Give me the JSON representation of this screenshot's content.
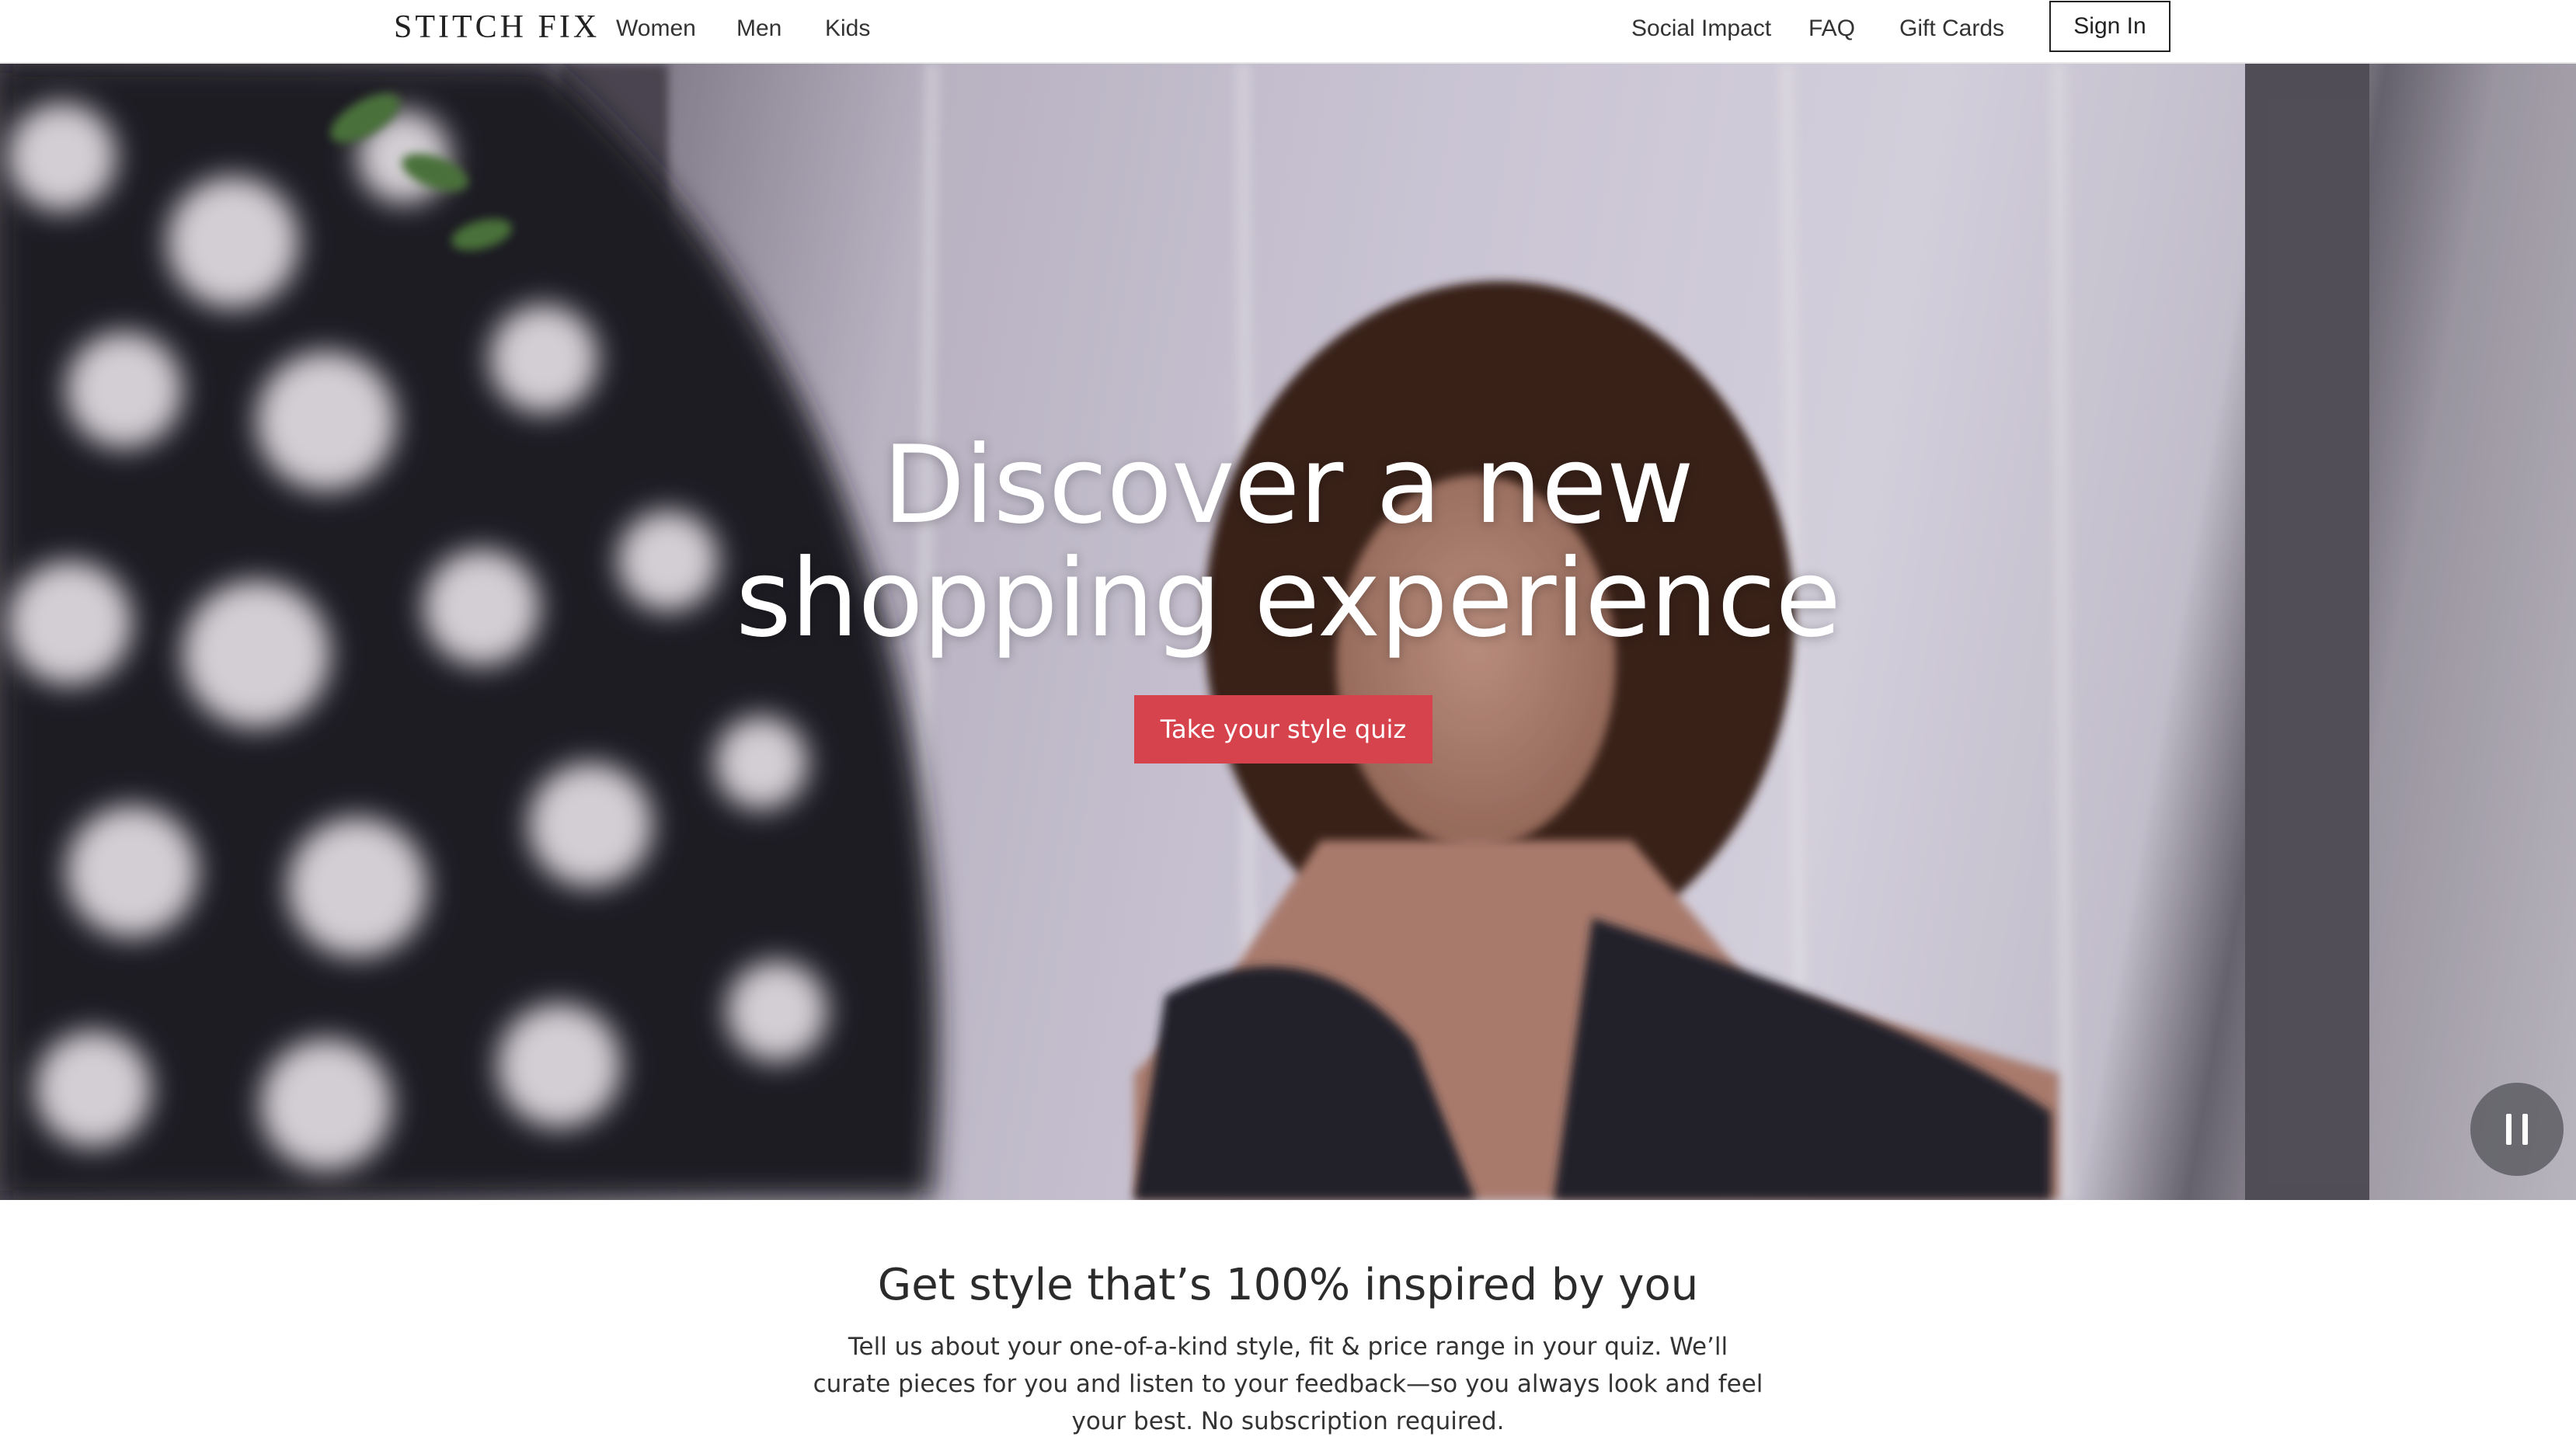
{
  "header": {
    "logo_text": "STITCH FIX",
    "nav_left": {
      "women": "Women",
      "men": "Men",
      "kids": "Kids"
    },
    "nav_right": {
      "social_impact": "Social Impact",
      "faq": "FAQ",
      "gift_cards": "Gift Cards"
    },
    "sign_in_label": "Sign In"
  },
  "hero": {
    "headline_line1": "Discover a new",
    "headline_line2": "shopping experience",
    "cta_label": "Take your style quiz",
    "cta_color": "#d7434c",
    "video_control_icon": "pause-icon"
  },
  "intro": {
    "title": "Get style that’s 100% inspired by you",
    "body": "Tell us about your one-of-a-kind style, fit & price range in your quiz. We’ll curate pieces for you and listen to your feedback—so you always look and feel your best. No subscription required."
  }
}
